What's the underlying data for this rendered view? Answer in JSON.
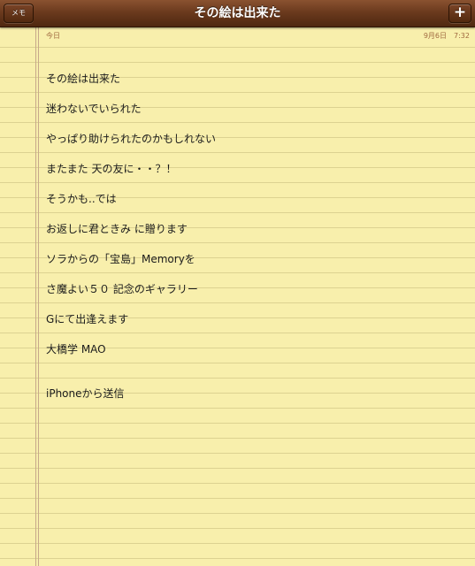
{
  "nav": {
    "back_label": "メモ",
    "title": "その絵は出来た",
    "add_label": "+"
  },
  "note": {
    "date_label": "今日",
    "date_time": "9月6日　7:32",
    "lines": [
      "その絵は出来た",
      "迷わないでいられた",
      "やっぱり助けられたのかもしれない",
      "またまた 天の友に・・？！",
      "そうかも..では",
      "お返しに君ときみ に贈ります",
      "ソラからの「宝島」Memoryを",
      "さ魔よい５０ 記念のギャラリー",
      "Gにて出逢えます",
      "大橋学 MAO"
    ],
    "signature": "iPhoneから送信"
  }
}
